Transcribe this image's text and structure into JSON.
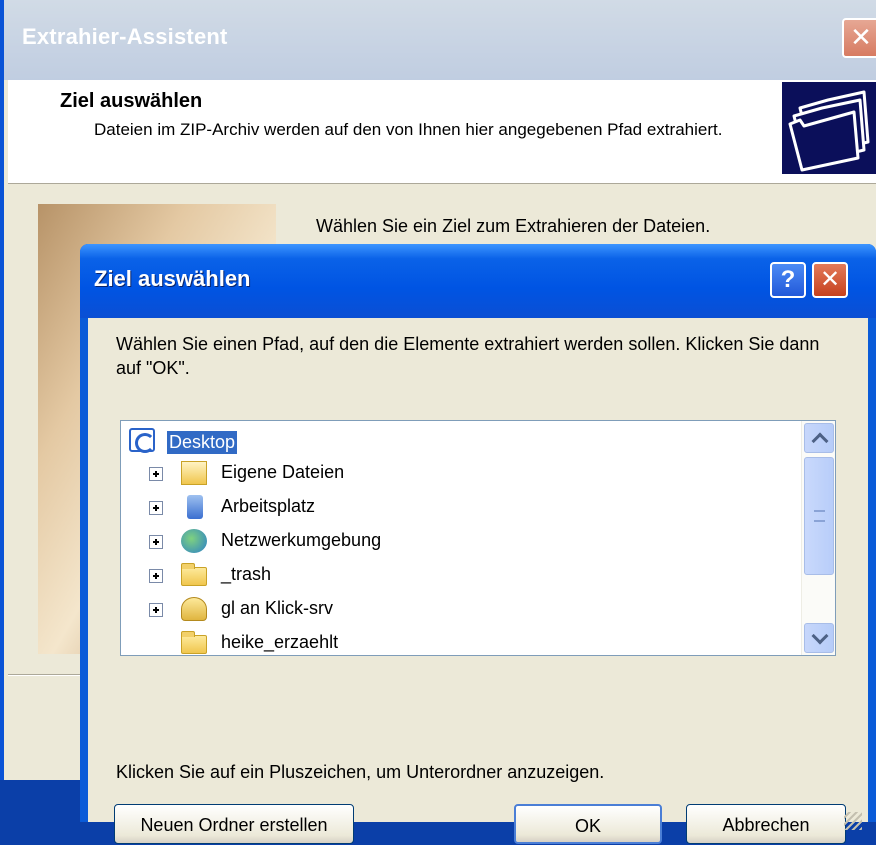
{
  "wizard": {
    "title": "Extrahier-Assistent",
    "header_title": "Ziel auswählen",
    "header_subtitle": "Dateien im ZIP-Archiv werden auf den von Ihnen hier angegebenen Pfad extrahiert.",
    "intro": "Wählen Sie ein Ziel zum Extrahieren der Dateien.",
    "close_glyph": "✕",
    "header_icon": "folders-icon"
  },
  "dialog": {
    "title": "Ziel auswählen",
    "help_glyph": "?",
    "close_glyph": "✕",
    "instruction": "Wählen Sie einen Pfad, auf den die Elemente extrahiert werden sollen. Klicken Sie dann auf \"OK\".",
    "tree": {
      "root": "Desktop",
      "items": [
        {
          "label": "Eigene Dateien",
          "icon": "documents-folder-icon"
        },
        {
          "label": "Arbeitsplatz",
          "icon": "computer-icon"
        },
        {
          "label": "Netzwerkumgebung",
          "icon": "network-icon"
        },
        {
          "label": "_trash",
          "icon": "folder-icon"
        },
        {
          "label": "gl an Klick-srv",
          "icon": "network-share-icon"
        },
        {
          "label": "heike_erzaehlt",
          "icon": "folder-icon"
        }
      ]
    },
    "hint": "Klicken Sie auf ein Pluszeichen, um Unterordner anzuzeigen.",
    "buttons": {
      "new_folder": "Neuen Ordner erstellen",
      "ok": "OK",
      "cancel": "Abbrechen"
    }
  },
  "colors": {
    "selection": "#316ac5",
    "titlebar": "#0054e3",
    "dialog_bg": "#ece9d8"
  }
}
